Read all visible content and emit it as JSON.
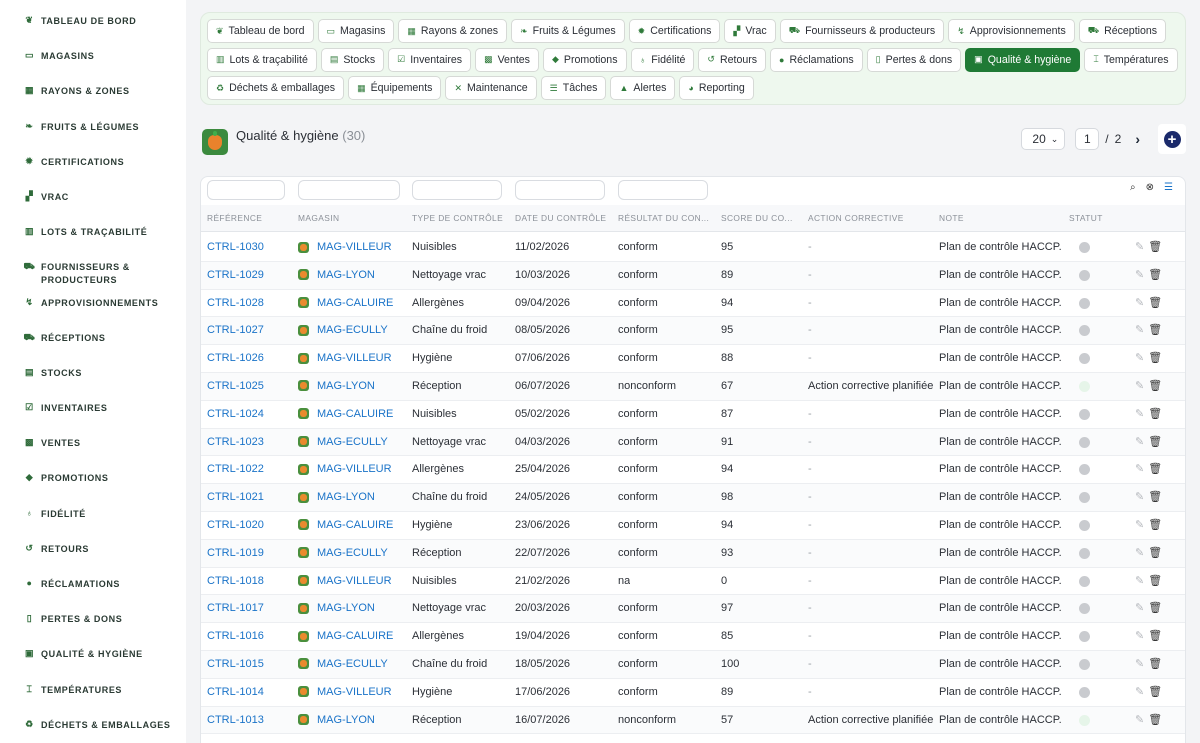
{
  "sidebar": {
    "items": [
      {
        "label": "TABLEAU DE BORD",
        "icon": "sprout-icon"
      },
      {
        "label": "MAGASINS",
        "icon": "store-icon"
      },
      {
        "label": "RAYONS & ZONES",
        "icon": "grid-icon"
      },
      {
        "label": "FRUITS & LÉGUMES",
        "icon": "leaf-icon"
      },
      {
        "label": "CERTIFICATIONS",
        "icon": "certificate-icon"
      },
      {
        "label": "VRAC",
        "icon": "boxes-icon"
      },
      {
        "label": "LOTS & TRAÇABILITÉ",
        "icon": "barcode-icon"
      },
      {
        "label": "FOURNISSEURS & PRODUCTEURS",
        "icon": "tractor-icon"
      },
      {
        "label": "APPROVISIONNEMENTS",
        "icon": "dolly-icon"
      },
      {
        "label": "RÉCEPTIONS",
        "icon": "truck-ramp-icon"
      },
      {
        "label": "STOCKS",
        "icon": "warehouse-icon"
      },
      {
        "label": "INVENTAIRES",
        "icon": "clipboard-check-icon"
      },
      {
        "label": "VENTES",
        "icon": "cash-register-icon"
      },
      {
        "label": "PROMOTIONS",
        "icon": "tag-icon"
      },
      {
        "label": "FIDÉLITÉ",
        "icon": "award-icon"
      },
      {
        "label": "RETOURS",
        "icon": "undo-icon"
      },
      {
        "label": "RÉCLAMATIONS",
        "icon": "comment-icon"
      },
      {
        "label": "PERTES & DONS",
        "icon": "trash-icon"
      },
      {
        "label": "QUALITÉ & HYGIÈNE",
        "icon": "clipboard-icon"
      },
      {
        "label": "TEMPÉRATURES",
        "icon": "thermometer-icon"
      },
      {
        "label": "DÉCHETS & EMBALLAGES",
        "icon": "recycle-icon"
      }
    ]
  },
  "nav": {
    "rows": [
      [
        {
          "label": "Tableau de bord",
          "icon": "sprout-icon",
          "glyph": "❦"
        },
        {
          "label": "Magasins",
          "icon": "store-icon",
          "glyph": "▭"
        },
        {
          "label": "Rayons & zones",
          "icon": "grid-icon",
          "glyph": "▦"
        },
        {
          "label": "Fruits & Légumes",
          "icon": "leaf-icon",
          "glyph": "❧"
        },
        {
          "label": "Certifications",
          "icon": "certificate-icon",
          "glyph": "✹"
        },
        {
          "label": "Vrac",
          "icon": "boxes-icon",
          "glyph": "▞"
        },
        {
          "label": "Fournisseurs & producteurs",
          "icon": "tractor-icon",
          "glyph": "⛟"
        },
        {
          "label": "Approvisionnements",
          "icon": "dolly-icon",
          "glyph": "↯"
        },
        {
          "label": "Réceptions",
          "icon": "truck-ramp-icon",
          "glyph": "⛟"
        }
      ],
      [
        {
          "label": "Lots & traçabilité",
          "icon": "barcode-icon",
          "glyph": "▥"
        },
        {
          "label": "Stocks",
          "icon": "warehouse-icon",
          "glyph": "▤"
        },
        {
          "label": "Inventaires",
          "icon": "clipboard-check-icon",
          "glyph": "☑"
        },
        {
          "label": "Ventes",
          "icon": "cash-register-icon",
          "glyph": "▩"
        },
        {
          "label": "Promotions",
          "icon": "tag-icon",
          "glyph": "◆"
        },
        {
          "label": "Fidélité",
          "icon": "award-icon",
          "glyph": "♁"
        },
        {
          "label": "Retours",
          "icon": "undo-icon",
          "glyph": "↺"
        },
        {
          "label": "Réclamations",
          "icon": "comment-icon",
          "glyph": "●"
        },
        {
          "label": "Pertes & dons",
          "icon": "trash-icon",
          "glyph": "▯"
        },
        {
          "label": "Qualité & hygiène",
          "icon": "clipboard-icon",
          "glyph": "▣",
          "active": true
        },
        {
          "label": "Températures",
          "icon": "thermometer-icon",
          "glyph": "⌶"
        }
      ],
      [
        {
          "label": "Déchets & emballages",
          "icon": "recycle-icon",
          "glyph": "♻"
        },
        {
          "label": "Équipements",
          "icon": "equipment-icon",
          "glyph": "▦"
        },
        {
          "label": "Maintenance",
          "icon": "tools-icon",
          "glyph": "✕"
        },
        {
          "label": "Tâches",
          "icon": "list-check-icon",
          "glyph": "☰"
        },
        {
          "label": "Alertes",
          "icon": "bell-icon",
          "glyph": "▲"
        },
        {
          "label": "Reporting",
          "icon": "pie-chart-icon",
          "glyph": "◕"
        }
      ]
    ]
  },
  "page": {
    "title": "Qualité & hygiène",
    "count": "(30)"
  },
  "pager": {
    "per_page": "20",
    "current_page": "1",
    "separator": "/",
    "total_pages": "2"
  },
  "table": {
    "columns": [
      {
        "label": "RÉFÉRENCE"
      },
      {
        "label": "MAGASIN"
      },
      {
        "label": "TYPE DE CONTRÔLE"
      },
      {
        "label": "DATE DU CONTRÔLE"
      },
      {
        "label": "RÉSULTAT DU CON..."
      },
      {
        "label": "SCORE DU CO..."
      },
      {
        "label": "ACTION CORRECTIVE"
      },
      {
        "label": "NOTE"
      },
      {
        "label": "STATUT"
      }
    ],
    "rows": [
      {
        "ref": "CTRL-1030",
        "store": "MAG-VILLEUR",
        "type": "Nuisibles",
        "date": "11/02/2026",
        "result": "conform",
        "score": "95",
        "action": "-",
        "note": "Plan de contrôle HACCP.",
        "status": "grey"
      },
      {
        "ref": "CTRL-1029",
        "store": "MAG-LYON",
        "type": "Nettoyage vrac",
        "date": "10/03/2026",
        "result": "conform",
        "score": "89",
        "action": "-",
        "note": "Plan de contrôle HACCP.",
        "status": "grey"
      },
      {
        "ref": "CTRL-1028",
        "store": "MAG-CALUIRE",
        "type": "Allergènes",
        "date": "09/04/2026",
        "result": "conform",
        "score": "94",
        "action": "-",
        "note": "Plan de contrôle HACCP.",
        "status": "grey"
      },
      {
        "ref": "CTRL-1027",
        "store": "MAG-ECULLY",
        "type": "Chaîne du froid",
        "date": "08/05/2026",
        "result": "conform",
        "score": "95",
        "action": "-",
        "note": "Plan de contrôle HACCP.",
        "status": "grey"
      },
      {
        "ref": "CTRL-1026",
        "store": "MAG-VILLEUR",
        "type": "Hygiène",
        "date": "07/06/2026",
        "result": "conform",
        "score": "88",
        "action": "-",
        "note": "Plan de contrôle HACCP.",
        "status": "grey"
      },
      {
        "ref": "CTRL-1025",
        "store": "MAG-LYON",
        "type": "Réception",
        "date": "06/07/2026",
        "result": "nonconform",
        "score": "67",
        "action": "Action corrective planifiée",
        "note": "Plan de contrôle HACCP.",
        "status": "light"
      },
      {
        "ref": "CTRL-1024",
        "store": "MAG-CALUIRE",
        "type": "Nuisibles",
        "date": "05/02/2026",
        "result": "conform",
        "score": "87",
        "action": "-",
        "note": "Plan de contrôle HACCP.",
        "status": "grey"
      },
      {
        "ref": "CTRL-1023",
        "store": "MAG-ECULLY",
        "type": "Nettoyage vrac",
        "date": "04/03/2026",
        "result": "conform",
        "score": "91",
        "action": "-",
        "note": "Plan de contrôle HACCP.",
        "status": "grey"
      },
      {
        "ref": "CTRL-1022",
        "store": "MAG-VILLEUR",
        "type": "Allergènes",
        "date": "25/04/2026",
        "result": "conform",
        "score": "94",
        "action": "-",
        "note": "Plan de contrôle HACCP.",
        "status": "grey"
      },
      {
        "ref": "CTRL-1021",
        "store": "MAG-LYON",
        "type": "Chaîne du froid",
        "date": "24/05/2026",
        "result": "conform",
        "score": "98",
        "action": "-",
        "note": "Plan de contrôle HACCP.",
        "status": "grey"
      },
      {
        "ref": "CTRL-1020",
        "store": "MAG-CALUIRE",
        "type": "Hygiène",
        "date": "23/06/2026",
        "result": "conform",
        "score": "94",
        "action": "-",
        "note": "Plan de contrôle HACCP.",
        "status": "grey"
      },
      {
        "ref": "CTRL-1019",
        "store": "MAG-ECULLY",
        "type": "Réception",
        "date": "22/07/2026",
        "result": "conform",
        "score": "93",
        "action": "-",
        "note": "Plan de contrôle HACCP.",
        "status": "grey"
      },
      {
        "ref": "CTRL-1018",
        "store": "MAG-VILLEUR",
        "type": "Nuisibles",
        "date": "21/02/2026",
        "result": "na",
        "score": "0",
        "action": "-",
        "note": "Plan de contrôle HACCP.",
        "status": "grey"
      },
      {
        "ref": "CTRL-1017",
        "store": "MAG-LYON",
        "type": "Nettoyage vrac",
        "date": "20/03/2026",
        "result": "conform",
        "score": "97",
        "action": "-",
        "note": "Plan de contrôle HACCP.",
        "status": "grey"
      },
      {
        "ref": "CTRL-1016",
        "store": "MAG-CALUIRE",
        "type": "Allergènes",
        "date": "19/04/2026",
        "result": "conform",
        "score": "85",
        "action": "-",
        "note": "Plan de contrôle HACCP.",
        "status": "grey"
      },
      {
        "ref": "CTRL-1015",
        "store": "MAG-ECULLY",
        "type": "Chaîne du froid",
        "date": "18/05/2026",
        "result": "conform",
        "score": "100",
        "action": "-",
        "note": "Plan de contrôle HACCP.",
        "status": "grey"
      },
      {
        "ref": "CTRL-1014",
        "store": "MAG-VILLEUR",
        "type": "Hygiène",
        "date": "17/06/2026",
        "result": "conform",
        "score": "89",
        "action": "-",
        "note": "Plan de contrôle HACCP.",
        "status": "grey"
      },
      {
        "ref": "CTRL-1013",
        "store": "MAG-LYON",
        "type": "Réception",
        "date": "16/07/2026",
        "result": "nonconform",
        "score": "57",
        "action": "Action corrective planifiée",
        "note": "Plan de contrôle HACCP.",
        "status": "light"
      }
    ]
  },
  "colors": {
    "accent_green": "#1f7a35",
    "link_blue": "#1a73c8",
    "nav_bg": "#eef8ee",
    "add_button": "#1b2a6b"
  }
}
